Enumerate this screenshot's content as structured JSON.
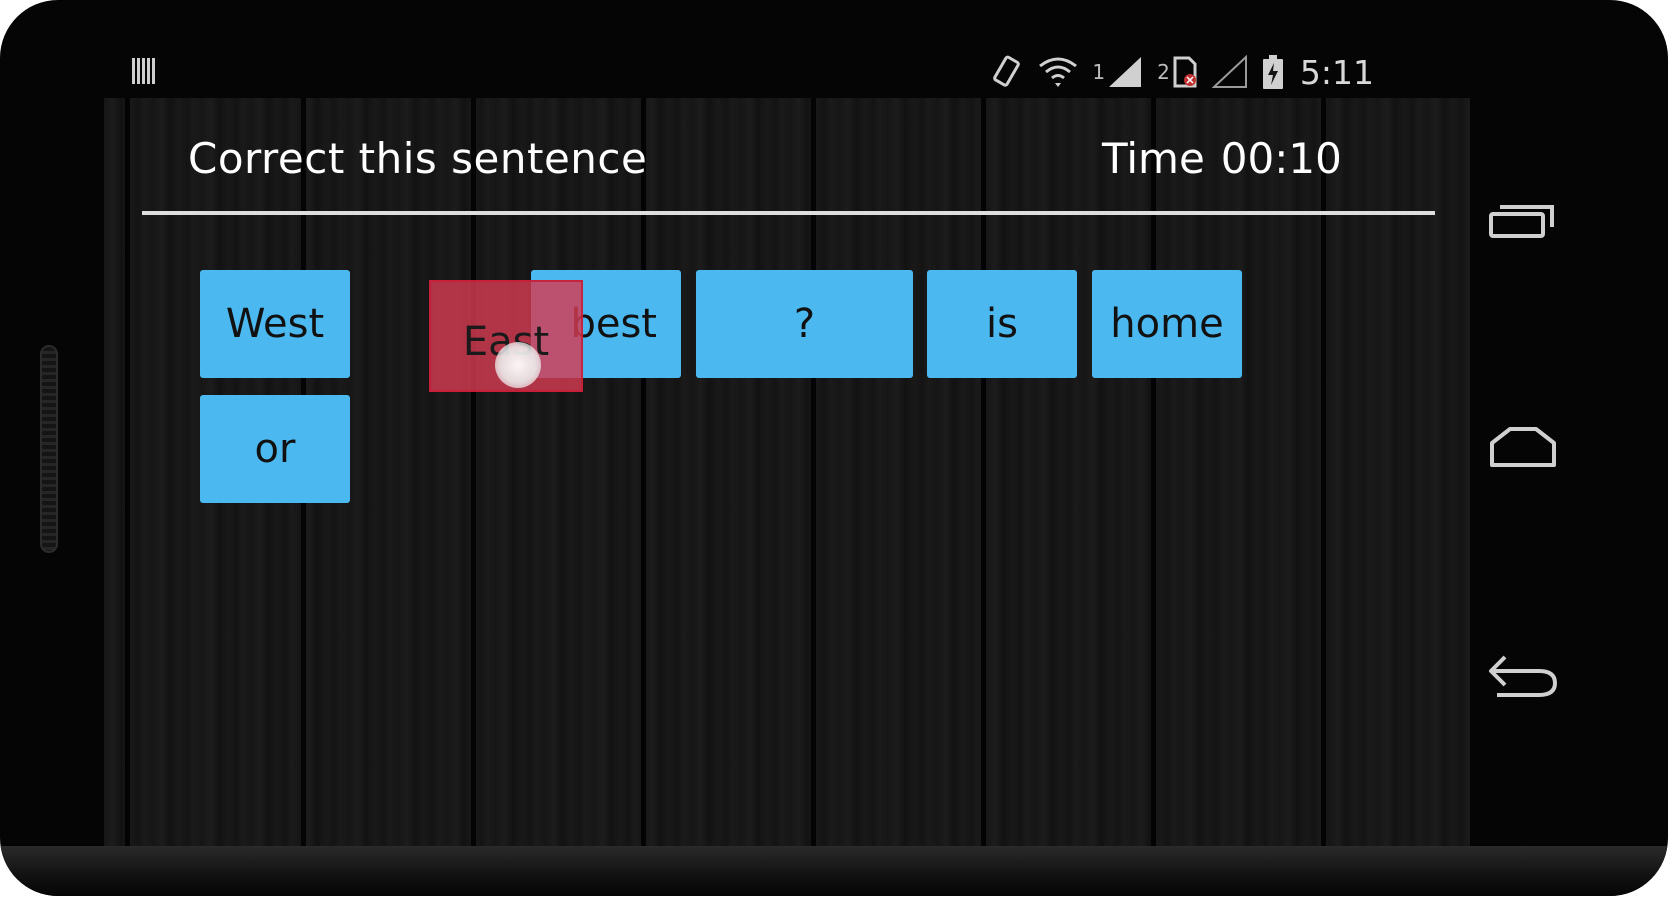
{
  "status_bar": {
    "notification_icon": "barcode-icon",
    "icons": [
      "screen-rotation-icon",
      "wifi-icon",
      "signal-icon",
      "sim-icon",
      "signal-empty-icon",
      "battery-charging-icon"
    ],
    "sim1_label": "1",
    "sim2_label": "2",
    "time": "5:11"
  },
  "header": {
    "title": "Correct this sentence",
    "timer_label": "Time",
    "timer_value": "00:10"
  },
  "word_tiles": [
    {
      "text": "West"
    },
    {
      "text": "or"
    },
    {
      "text": "best"
    },
    {
      "text": "?"
    },
    {
      "text": "is"
    },
    {
      "text": "home"
    }
  ],
  "dragging_tile": {
    "text": "East"
  },
  "nav_bar": {
    "buttons": [
      "recent-apps-icon",
      "home-icon",
      "back-icon"
    ]
  },
  "colors": {
    "tile": "#4bb8f0",
    "dragging_tile": "#d43a52",
    "text_on_dark": "#ffffff",
    "background": "#141414"
  }
}
